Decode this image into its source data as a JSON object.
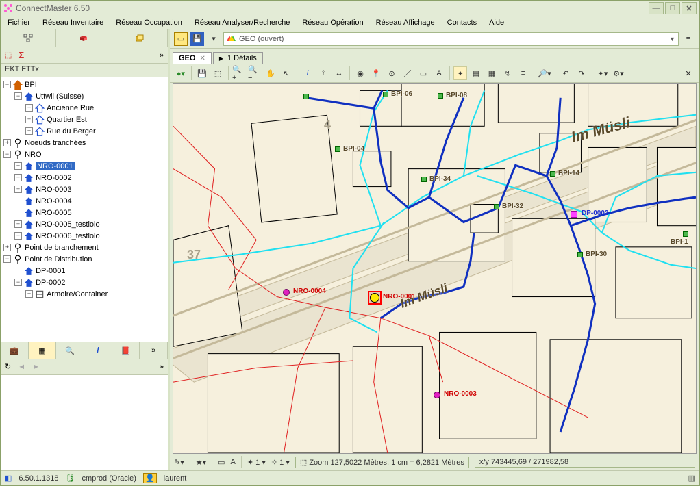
{
  "app": {
    "title": "ConnectMaster 6.50"
  },
  "menu": {
    "items": [
      "Fichier",
      "Réseau Inventaire",
      "Réseau Occupation",
      "Réseau Analyser/Recherche",
      "Réseau Opération",
      "Réseau Affichage",
      "Contacts",
      "Aide"
    ]
  },
  "left": {
    "project": "EKT FTTx",
    "tree": {
      "bpi": "BPI",
      "uttwil": "Uttwil (Suisse)",
      "anc": "Ancienne Rue",
      "qest": "Quartier Est",
      "rdb": "Rue du Berger",
      "noeuds": "Noeuds tranchées",
      "nro": "NRO",
      "nro1": "NRO-0001",
      "nro2": "NRO-0002",
      "nro3": "NRO-0003",
      "nro4": "NRO-0004",
      "nro5": "NRO-0005",
      "nro5t": "NRO-0005_testlolo",
      "nro6t": "NRO-0006_testlolo",
      "pbr": "Point de branchement",
      "pdi": "Point de Distribution",
      "dp1": "DP-0001",
      "dp2": "DP-0002",
      "arm": "Armoire/Container"
    },
    "sigma": "Σ"
  },
  "doc": {
    "dropdown_icon_label": "GEO  (ouvert)",
    "tab_geo": "GEO",
    "tab_details": "1 Détails",
    "tab_details_icon": "▶"
  },
  "map": {
    "q_top": "4",
    "q_left": "37",
    "street": "Im Müsli",
    "bpi06": "BPI-06",
    "bpi08": "BPI-08",
    "bpi04": "BPI-04",
    "bpi34": "BPI-34",
    "bpi14": "BPI-14",
    "bpi32": "BPI-32",
    "bpi30": "BPI-30",
    "bpi1": "BPI-1",
    "dp2": "DP-0002",
    "nro4": "NRO-0004",
    "nro1": "NRO-0001",
    "nro3": "NRO-0003"
  },
  "map_status": {
    "zoom": "Zoom 127,5022 Mètres, 1 cm = 6,2821 Mètres",
    "xy": "x/y 743445,69 / 271982,58",
    "menu1": "1",
    "menu2": "1",
    "letterA": "A"
  },
  "status": {
    "version": "6.50.1.1318",
    "db": "cmprod  (Oracle)",
    "user": "laurent"
  },
  "colors": {
    "accent_bg": "#e3ebd6",
    "select_blue": "#316ac5",
    "cyan": "#00e0ff",
    "dark_blue_line": "#1030c0",
    "red_line": "#e02020"
  }
}
